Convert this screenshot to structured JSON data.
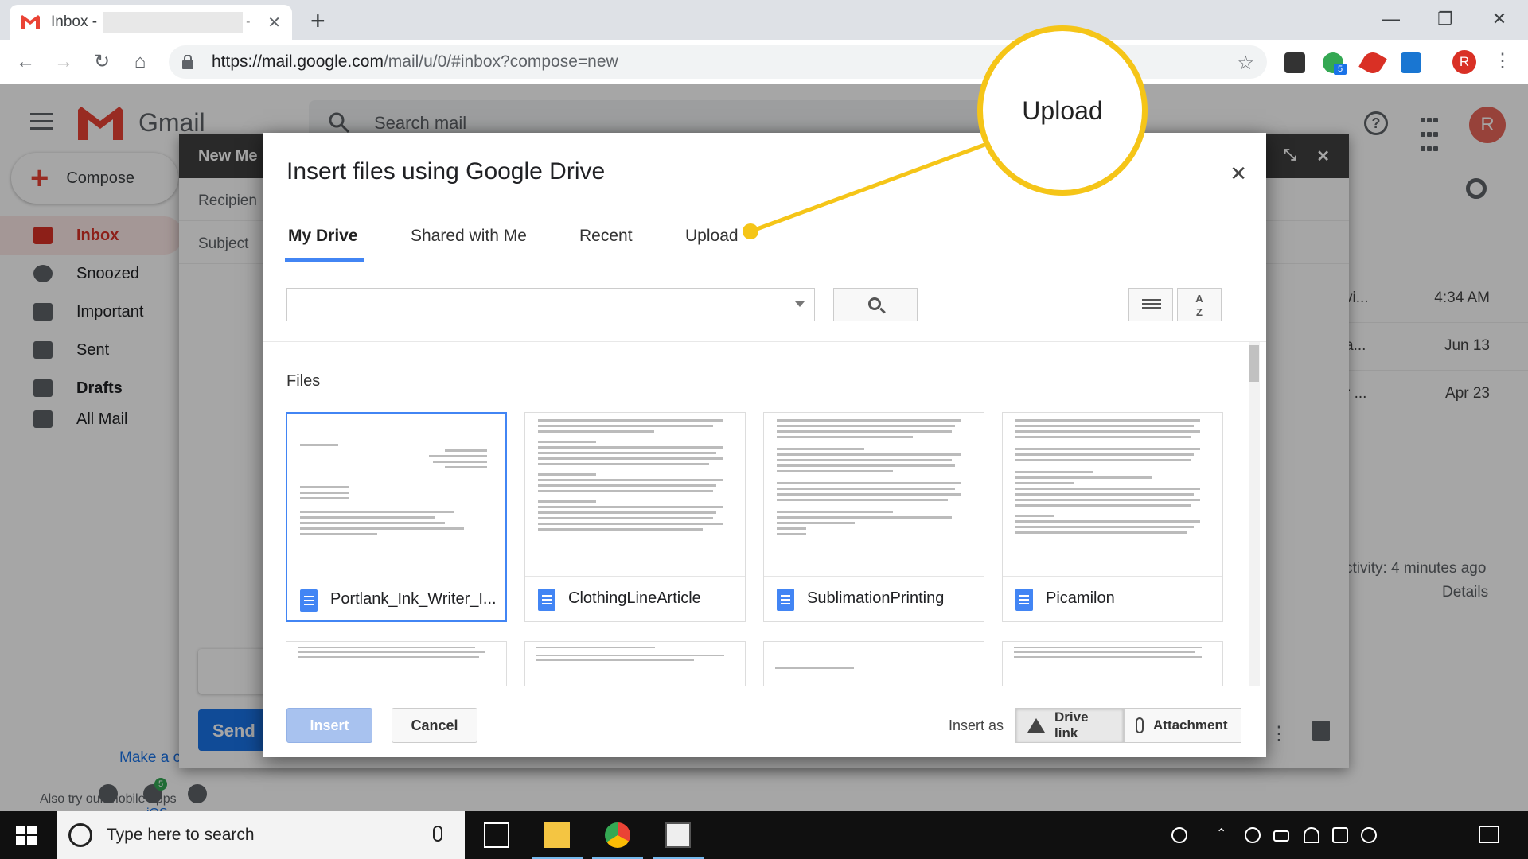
{
  "browser": {
    "tab_title": "Inbox -",
    "tab_separator": "-",
    "url_host": "https://mail.google.com",
    "url_path": "/mail/u/0/#inbox?compose=new",
    "profile_initial": "R",
    "extension_badge": "5"
  },
  "gmail": {
    "logo_text": "Gmail",
    "search_placeholder": "Search mail",
    "avatar_initial": "R",
    "compose_label": "Compose",
    "nav": [
      {
        "label": "Inbox"
      },
      {
        "label": "Snoozed"
      },
      {
        "label": "Important"
      },
      {
        "label": "Sent"
      },
      {
        "label": "Drafts"
      },
      {
        "label": "All Mail"
      }
    ],
    "mail_rows": [
      {
        "snippet": "vi...",
        "time": "4:34 AM"
      },
      {
        "snippet": "a...",
        "time": "Jun 13"
      },
      {
        "snippet": "r ...",
        "time": "Apr 23"
      }
    ],
    "activity": "ctivity: 4 minutes ago",
    "details": "Details",
    "make_default": "Make a c",
    "mobile_apps": "Also try our mobile apps",
    "ios": "iOS",
    "hangouts_badge": "5"
  },
  "compose_window": {
    "title": "New Me",
    "recipients": "Recipien",
    "subject": "Subject",
    "send": "Send"
  },
  "dialog": {
    "title": "Insert files using Google Drive",
    "tabs": [
      {
        "label": "My Drive",
        "active": true
      },
      {
        "label": "Shared with Me",
        "active": false
      },
      {
        "label": "Recent",
        "active": false
      },
      {
        "label": "Upload",
        "active": false
      }
    ],
    "files_label": "Files",
    "files": [
      {
        "name": "Portlank_Ink_Writer_I...",
        "selected": true
      },
      {
        "name": "ClothingLineArticle",
        "selected": false
      },
      {
        "name": "SublimationPrinting",
        "selected": false
      },
      {
        "name": "Picamilon",
        "selected": false
      }
    ],
    "insert_button": "Insert",
    "cancel_button": "Cancel",
    "insert_as_label": "Insert as",
    "drive_link": "Drive link",
    "attachment": "Attachment"
  },
  "callout": {
    "text": "Upload",
    "color": "#f5c518"
  },
  "taskbar": {
    "search_placeholder": "Type here to search"
  }
}
